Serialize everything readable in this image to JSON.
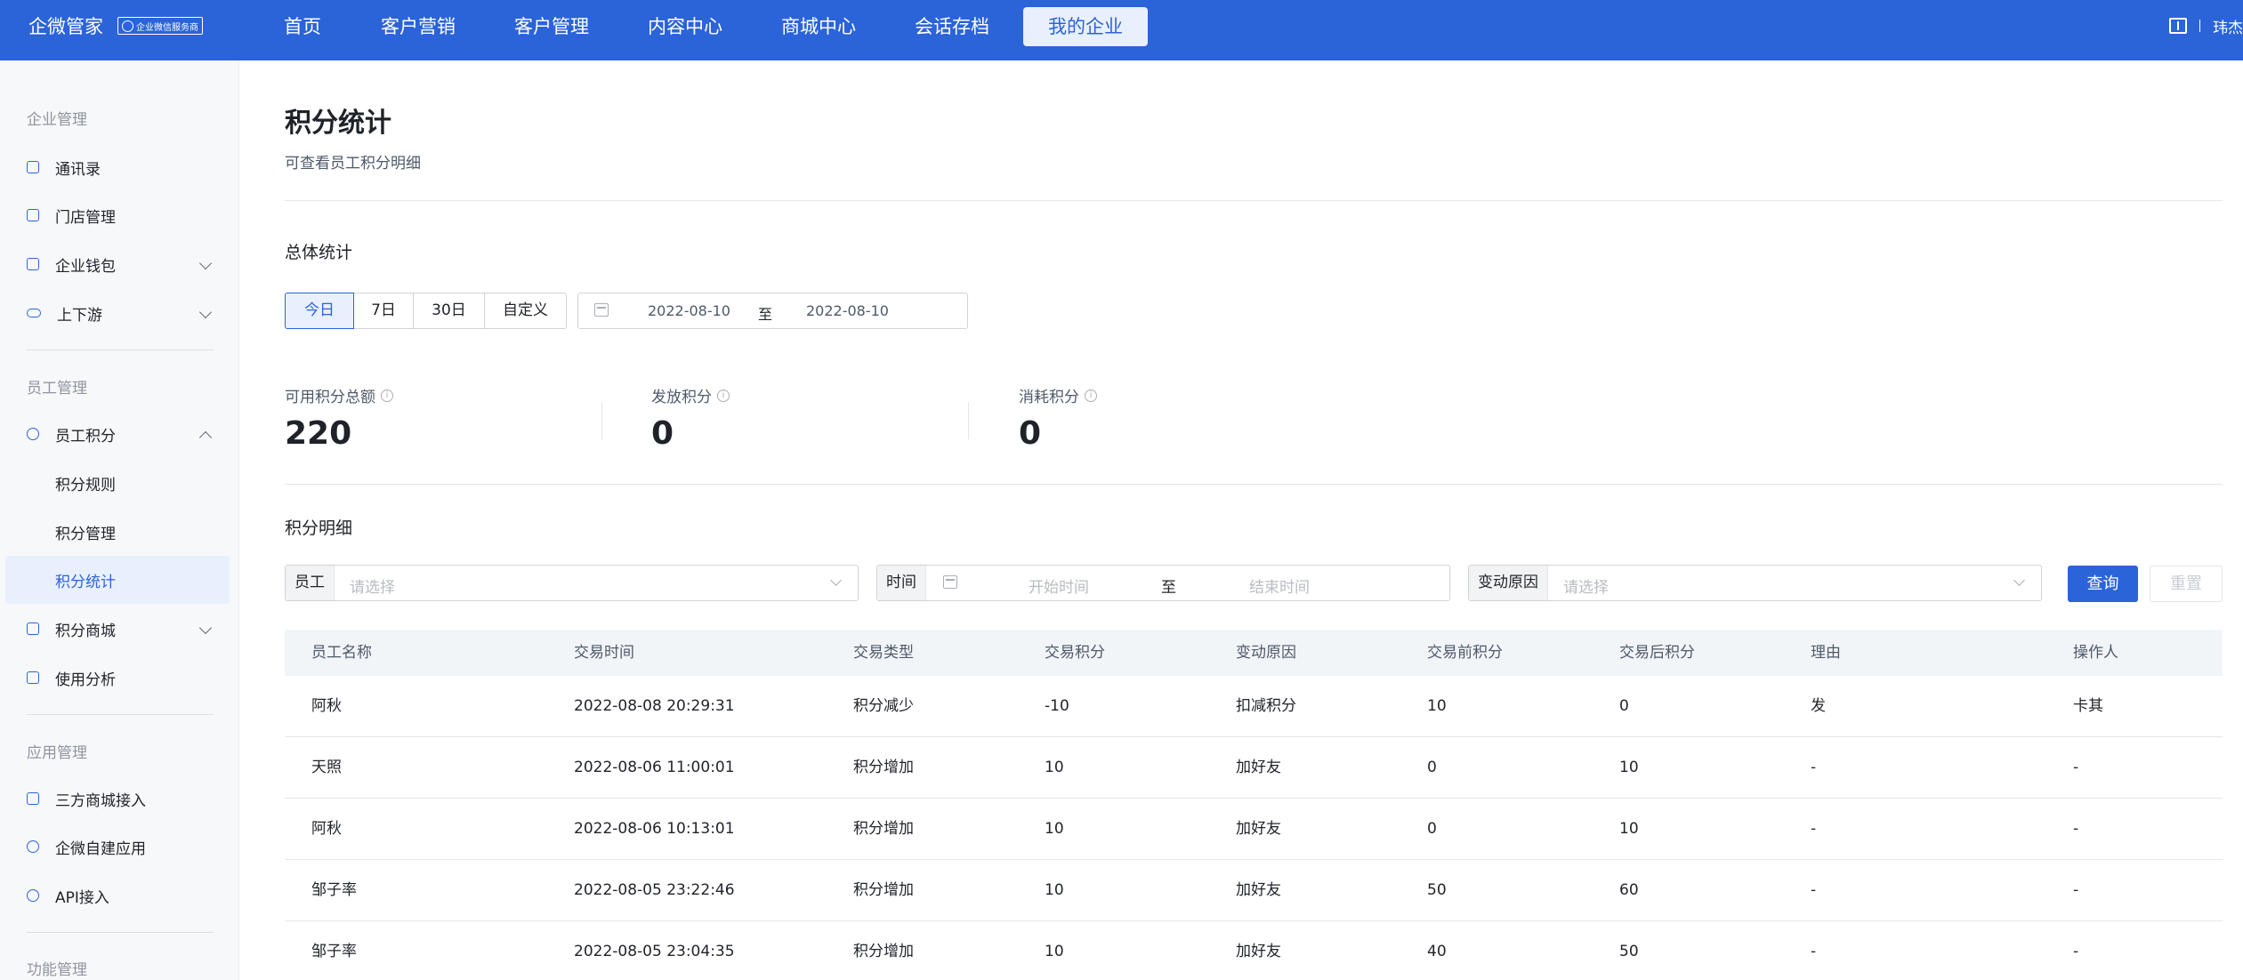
{
  "header": {
    "brand": "企微管家",
    "badge": "企业微信服务商",
    "nav": [
      "首页",
      "客户营销",
      "客户管理",
      "内容中心",
      "商城中心",
      "会话存档",
      "我的企业"
    ],
    "active_nav": "我的企业",
    "user": "玮杰",
    "separator": "|"
  },
  "sidebar": {
    "groups": {
      "enterprise": "企业管理",
      "staff": "员工管理",
      "apps": "应用管理",
      "features": "功能管理"
    },
    "items": {
      "contacts": "通讯录",
      "stores": "门店管理",
      "wallet": "企业钱包",
      "supply": "上下游",
      "points": "员工积分",
      "points_rules": "积分规则",
      "points_manage": "积分管理",
      "points_stats": "积分统计",
      "points_mall": "积分商城",
      "usage": "使用分析",
      "third_mall": "三方商城接入",
      "self_app": "企微自建应用",
      "api": "API接入"
    }
  },
  "page": {
    "title": "积分统计",
    "subtitle": "可查看员工积分明细"
  },
  "overview": {
    "title": "总体统计",
    "ranges": [
      "今日",
      "7日",
      "30日",
      "自定义"
    ],
    "active_range": "今日",
    "date_from": "2022-08-10",
    "date_to": "2022-08-10",
    "date_sep": "至",
    "stats": [
      {
        "label": "可用积分总额",
        "value": "220"
      },
      {
        "label": "发放积分",
        "value": "0"
      },
      {
        "label": "消耗积分",
        "value": "0"
      }
    ]
  },
  "detail": {
    "title": "积分明细",
    "filters": {
      "staff_label": "员工",
      "staff_placeholder": "请选择",
      "time_label": "时间",
      "time_start": "开始时间",
      "time_sep": "至",
      "time_end": "结束时间",
      "reason_label": "变动原因",
      "reason_placeholder": "请选择",
      "query": "查询",
      "reset": "重置"
    },
    "columns": [
      "员工名称",
      "交易时间",
      "交易类型",
      "交易积分",
      "变动原因",
      "交易前积分",
      "交易后积分",
      "理由",
      "操作人"
    ],
    "rows": [
      [
        "阿秋",
        "2022-08-08 20:29:31",
        "积分减少",
        "-10",
        "扣减积分",
        "10",
        "0",
        "发",
        "卡其"
      ],
      [
        "天照",
        "2022-08-06 11:00:01",
        "积分增加",
        "10",
        "加好友",
        "0",
        "10",
        "-",
        "-"
      ],
      [
        "阿秋",
        "2022-08-06 10:13:01",
        "积分增加",
        "10",
        "加好友",
        "0",
        "10",
        "-",
        "-"
      ],
      [
        "邹子率",
        "2022-08-05 23:22:46",
        "积分增加",
        "10",
        "加好友",
        "50",
        "60",
        "-",
        "-"
      ],
      [
        "邹子率",
        "2022-08-05 23:04:35",
        "积分增加",
        "10",
        "加好友",
        "40",
        "50",
        "-",
        "-"
      ]
    ]
  },
  "colors": {
    "primary": "#2b63d9",
    "active_bg": "#e9f0fd"
  }
}
